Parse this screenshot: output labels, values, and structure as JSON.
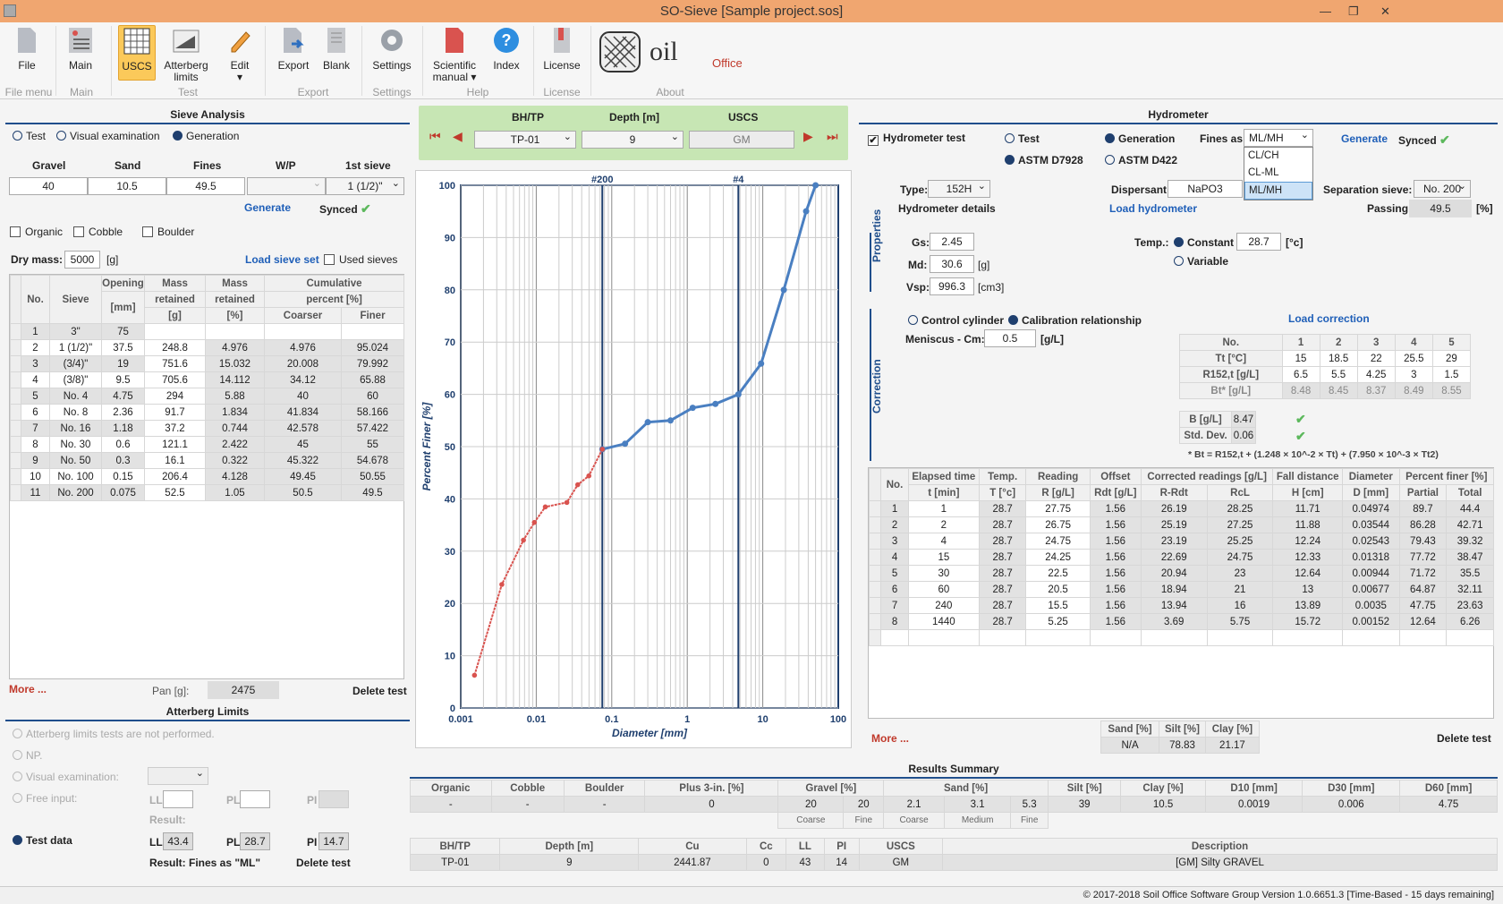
{
  "window": {
    "title": "SO-Sieve [Sample project.sos]"
  },
  "ribbon": {
    "buttons": [
      {
        "label": "File",
        "name": "file"
      },
      {
        "label": "Main",
        "name": "main"
      },
      {
        "label": "USCS",
        "name": "uscs"
      },
      {
        "label": "Atterberg limits",
        "name": "atterberg"
      },
      {
        "label": "Edit",
        "name": "edit"
      },
      {
        "label": "Export",
        "name": "export"
      },
      {
        "label": "Blank",
        "name": "blank"
      },
      {
        "label": "Settings",
        "name": "settings"
      },
      {
        "label": "Scientific manual",
        "name": "manual"
      },
      {
        "label": "Index",
        "name": "index"
      },
      {
        "label": "License",
        "name": "license"
      }
    ],
    "groups": [
      "File menu",
      "Main",
      "Test",
      "Export",
      "Settings",
      "Help",
      "License",
      "About"
    ],
    "logo_text": "oil",
    "logo_sub": "Office"
  },
  "sieve": {
    "title": "Sieve Analysis",
    "modes": [
      "Test",
      "Visual examination",
      "Generation"
    ],
    "cols": [
      "Gravel",
      "Sand",
      "Fines",
      "W/P",
      "1st sieve"
    ],
    "vals": [
      "40",
      "10.5",
      "49.5",
      "",
      "1 (1/2)\""
    ],
    "generate": "Generate",
    "synced": "Synced",
    "checks": [
      "Organic",
      "Cobble",
      "Boulder"
    ],
    "dry_mass_label": "Dry mass:",
    "dry_mass": "5000",
    "dry_unit": "[g]",
    "load": "Load sieve set",
    "used": "Used sieves",
    "headers": [
      "No.",
      "Sieve",
      "Opening",
      "Mass",
      "Mass",
      "Cumulative"
    ],
    "headers2": [
      "[mm]",
      "retained",
      "retained",
      "percent [%]"
    ],
    "headers3": [
      "[g]",
      "[%]",
      "Coarser",
      "Finer"
    ],
    "rows": [
      [
        "1",
        "3\"",
        "75",
        "",
        "",
        "",
        ""
      ],
      [
        "2",
        "1 (1/2)\"",
        "37.5",
        "248.8",
        "4.976",
        "4.976",
        "95.024"
      ],
      [
        "3",
        "(3/4)\"",
        "19",
        "751.6",
        "15.032",
        "20.008",
        "79.992"
      ],
      [
        "4",
        "(3/8)\"",
        "9.5",
        "705.6",
        "14.112",
        "34.12",
        "65.88"
      ],
      [
        "5",
        "No. 4",
        "4.75",
        "294",
        "5.88",
        "40",
        "60"
      ],
      [
        "6",
        "No. 8",
        "2.36",
        "91.7",
        "1.834",
        "41.834",
        "58.166"
      ],
      [
        "7",
        "No. 16",
        "1.18",
        "37.2",
        "0.744",
        "42.578",
        "57.422"
      ],
      [
        "8",
        "No. 30",
        "0.6",
        "121.1",
        "2.422",
        "45",
        "55"
      ],
      [
        "9",
        "No. 50",
        "0.3",
        "16.1",
        "0.322",
        "45.322",
        "54.678"
      ],
      [
        "10",
        "No. 100",
        "0.15",
        "206.4",
        "4.128",
        "49.45",
        "50.55"
      ],
      [
        "11",
        "No. 200",
        "0.075",
        "52.5",
        "1.05",
        "50.5",
        "49.5"
      ]
    ],
    "more": "More ...",
    "pan_label": "Pan [g]:",
    "pan": "2475",
    "delete": "Delete test"
  },
  "atterberg": {
    "title": "Atterberg Limits",
    "opt1": "Atterberg limits tests are not performed.",
    "opt2": "NP.",
    "opt3": "Visual examination:",
    "opt4": "Free input:",
    "ll": "LL",
    "pl": "PL",
    "pi": "PI",
    "result": "Result:",
    "test": "Test data",
    "ll_v": "43.4",
    "pl_v": "28.7",
    "pi_v": "14.7",
    "result2": "Result:  Fines as \"ML\"",
    "delete": "Delete test"
  },
  "nav": {
    "h1": "BH/TP",
    "h2": "Depth [m]",
    "h3": "USCS",
    "bh": "TP-01",
    "depth": "9",
    "uscs": "GM"
  },
  "chart_data": {
    "type": "line",
    "xscale": "log",
    "xlim": [
      0.001,
      100
    ],
    "ylim": [
      0,
      100
    ],
    "xlabel": "Diameter [mm]",
    "ylabel": "Percent Finer [%]",
    "xticks": [
      "0.001",
      "0.01",
      "0.1",
      "1",
      "10",
      "100"
    ],
    "yticks": [
      "0",
      "10",
      "20",
      "30",
      "40",
      "50",
      "60",
      "70",
      "80",
      "90",
      "100"
    ],
    "vlines": [
      {
        "label": "#200",
        "x": 0.075
      },
      {
        "label": "#4",
        "x": 4.75
      }
    ],
    "series": [
      {
        "color": "#4a7fc1",
        "x": [
          0.075,
          0.15,
          0.3,
          0.6,
          1.18,
          2.36,
          4.75,
          9.5,
          19,
          37.5,
          50
        ],
        "y": [
          49.5,
          50.55,
          54.678,
          55,
          57.422,
          58.166,
          60,
          65.88,
          79.992,
          95.024,
          100
        ]
      },
      {
        "color": "#d9534f",
        "x": [
          0.00152,
          0.0035,
          0.00677,
          0.00944,
          0.01318,
          0.02543,
          0.03544,
          0.04974,
          0.075
        ],
        "y": [
          6.26,
          23.63,
          32.11,
          35.5,
          38.47,
          39.32,
          42.71,
          44.4,
          49.5
        ]
      }
    ]
  },
  "hydro": {
    "title": "Hydrometer",
    "test_chk": "Hydrometer test",
    "m_test": "Test",
    "m_gen": "Generation",
    "fines_as": "Fines as:",
    "fines_val": "ML/MH",
    "dropdown": [
      "CL/CH",
      "CL-ML",
      "ML/MH"
    ],
    "generate": "Generate",
    "synced": "Synced",
    "astm1": "ASTM D7928",
    "astm2": "ASTM D422",
    "type_l": "Type:",
    "type_v": "152H",
    "disp_l": "Dispersant:",
    "disp_v": "NaPO3",
    "sep_l": "Separation sieve:",
    "sep_v": "No. 200",
    "details": "Hydrometer details",
    "load_h": "Load hydrometer",
    "passing_l": "Passing:",
    "passing_v": "49.5",
    "pct": "[%]",
    "props": "Properties",
    "gs_l": "Gs:",
    "gs": "2.45",
    "md_l": "Md:",
    "md": "30.6",
    "md_u": "[g]",
    "vsp_l": "Vsp:",
    "vsp": "996.3",
    "vsp_u": "[cm3]",
    "temp_l": "Temp.:",
    "const": "Constant",
    "temp_v": "28.7",
    "temp_u": "[°c]",
    "var": "Variable",
    "corr": "Correction",
    "ctrl": "Control cylinder",
    "calib": "Calibration relationship",
    "load_c": "Load correction",
    "menis_l": "Meniscus - Cm:",
    "menis": "0.5",
    "menis_u": "[g/L]",
    "ct_h": [
      "No.",
      "1",
      "2",
      "3",
      "4",
      "5"
    ],
    "ct_rows": [
      [
        "Tt [°C]",
        "15",
        "18.5",
        "22",
        "25.5",
        "29"
      ],
      [
        "R152,t [g/L]",
        "6.5",
        "5.5",
        "4.25",
        "3",
        "1.5"
      ],
      [
        "Bt* [g/L]",
        "8.48",
        "8.45",
        "8.37",
        "8.49",
        "8.55"
      ]
    ],
    "b_l": "B  [g/L]",
    "b": "8.47",
    "sd_l": "Std. Dev.",
    "sd": "0.06",
    "formula": "* Bt = R152,t + (1.248 × 10^-2 × Tt) + (7.950 × 10^-3 × Tt2)",
    "h1": [
      "No.",
      "Elapsed time",
      "Temp.",
      "Reading",
      "Offset",
      "Corrected readings [g/L]",
      "Fall distance",
      "Diameter",
      "Percent finer [%]"
    ],
    "h2": [
      "t [min]",
      "T [°c]",
      "R [g/L]",
      "Rdt [g/L]",
      "R-Rdt",
      "RcL",
      "H [cm]",
      "D [mm]",
      "Partial",
      "Total"
    ],
    "rows": [
      [
        "1",
        "1",
        "28.7",
        "27.75",
        "1.56",
        "26.19",
        "28.25",
        "11.71",
        "0.04974",
        "89.7",
        "44.4"
      ],
      [
        "2",
        "2",
        "28.7",
        "26.75",
        "1.56",
        "25.19",
        "27.25",
        "11.88",
        "0.03544",
        "86.28",
        "42.71"
      ],
      [
        "3",
        "4",
        "28.7",
        "24.75",
        "1.56",
        "23.19",
        "25.25",
        "12.24",
        "0.02543",
        "79.43",
        "39.32"
      ],
      [
        "4",
        "15",
        "28.7",
        "24.25",
        "1.56",
        "22.69",
        "24.75",
        "12.33",
        "0.01318",
        "77.72",
        "38.47"
      ],
      [
        "5",
        "30",
        "28.7",
        "22.5",
        "1.56",
        "20.94",
        "23",
        "12.64",
        "0.00944",
        "71.72",
        "35.5"
      ],
      [
        "6",
        "60",
        "28.7",
        "20.5",
        "1.56",
        "18.94",
        "21",
        "13",
        "0.00677",
        "64.87",
        "32.11"
      ],
      [
        "7",
        "240",
        "28.7",
        "15.5",
        "1.56",
        "13.94",
        "16",
        "13.89",
        "0.0035",
        "47.75",
        "23.63"
      ],
      [
        "8",
        "1440",
        "28.7",
        "5.25",
        "1.56",
        "3.69",
        "5.75",
        "15.72",
        "0.00152",
        "12.64",
        "6.26"
      ]
    ],
    "more": "More ...",
    "sand_l": "Sand [%]",
    "silt_l": "Silt [%]",
    "clay_l": "Clay [%]",
    "sand": "N/A",
    "silt": "78.83",
    "clay": "21.17",
    "delete": "Delete test"
  },
  "results": {
    "title": "Results Summary",
    "h": [
      "Organic",
      "Cobble",
      "Boulder",
      "Plus 3-in. [%]",
      "Gravel [%]",
      "Sand [%]",
      "Silt [%]",
      "Clay [%]",
      "D10 [mm]",
      "D30 [mm]",
      "D60 [mm]"
    ],
    "v": [
      "-",
      "-",
      "-",
      "0",
      "20",
      "20",
      "2.1",
      "3.1",
      "5.3",
      "39",
      "10.5",
      "0.0019",
      "0.006",
      "4.75"
    ],
    "sub": [
      "Coarse",
      "Fine",
      "Coarse",
      "Medium",
      "Fine"
    ],
    "h2": [
      "BH/TP",
      "Depth [m]",
      "Cu",
      "Cc",
      "LL",
      "PI",
      "USCS",
      "Description"
    ],
    "v2": [
      "TP-01",
      "9",
      "2441.87",
      "0",
      "43",
      "14",
      "GM",
      "[GM] Silty GRAVEL"
    ]
  },
  "footer": {
    "text": "© 2017-2018 Soil Office Software Group   Version 1.0.6651.3 [Time-Based - 15 days remaining]"
  }
}
